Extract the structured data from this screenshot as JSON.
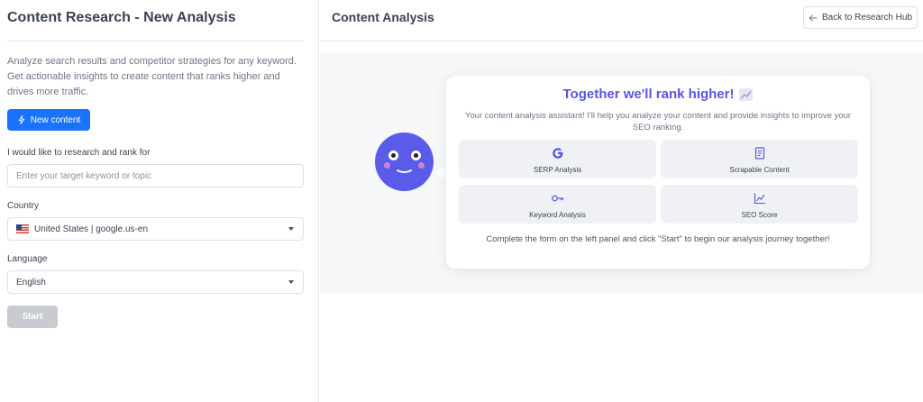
{
  "left": {
    "title": "Content Research - New Analysis",
    "description": "Analyze search results and competitor strategies for any keyword. Get actionable insights to create content that ranks higher and drives more traffic.",
    "new_button": "New content",
    "keyword_label": "I would like to research and rank for",
    "keyword_placeholder": "Enter your target keyword or topic",
    "country_label": "Country",
    "country_value": "United States | google.us-en",
    "language_label": "Language",
    "language_value": "English",
    "start_button": "Start"
  },
  "right": {
    "title": "Content Analysis",
    "back_button": "Back to Research Hub",
    "card": {
      "title": "Together we'll rank higher!",
      "subtitle": "Your content analysis assistant! I'll help you analyze your content and provide insights to improve your SEO ranking.",
      "tiles": [
        {
          "label": "SERP Analysis",
          "icon": "google-g-icon"
        },
        {
          "label": "Scrapable Content",
          "icon": "document-icon"
        },
        {
          "label": "Keyword Analysis",
          "icon": "key-icon"
        },
        {
          "label": "SEO Score",
          "icon": "line-chart-icon"
        }
      ],
      "footer": "Complete the form on the left panel and click \"Start\" to begin our analysis journey together!"
    }
  },
  "colors": {
    "primary": "#1a73ff",
    "accent": "#5a55e0",
    "avatar": "#5b5bea",
    "disabled": "#c8cbd0"
  }
}
